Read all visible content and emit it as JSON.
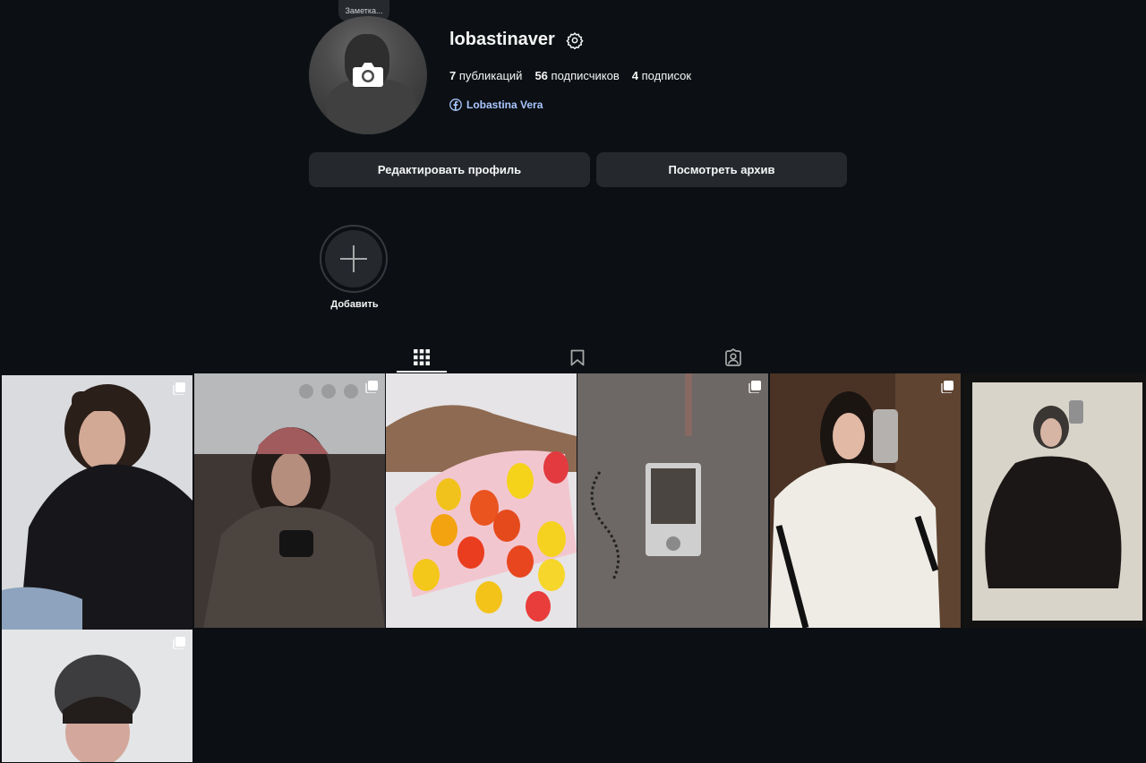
{
  "profile": {
    "note": "Заметка...",
    "username": "lobastinaver",
    "stats": {
      "posts_count": "7",
      "posts_label": "публикаций",
      "followers_count": "56",
      "followers_label": "подписчиков",
      "following_count": "4",
      "following_label": "подписок"
    },
    "facebook_link": "Lobastina Vera"
  },
  "buttons": {
    "edit_profile": "Редактировать профиль",
    "view_archive": "Посмотреть архив"
  },
  "highlights": {
    "add_label": "Добавить"
  },
  "tabs": [
    {
      "name": "posts",
      "icon": "grid-icon",
      "active": true
    },
    {
      "name": "saved",
      "icon": "bookmark-icon",
      "active": false
    },
    {
      "name": "tagged",
      "icon": "tagged-user-icon",
      "active": false
    }
  ],
  "grid": [
    {
      "id": 1,
      "multi": true
    },
    {
      "id": 2,
      "multi": true
    },
    {
      "id": 3,
      "multi": false
    },
    {
      "id": 4,
      "multi": true
    },
    {
      "id": 5,
      "multi": true
    },
    {
      "id": 6,
      "multi": false
    },
    {
      "id": 7,
      "multi": true
    }
  ],
  "colors": {
    "background": "#0c1014",
    "button": "#25292e",
    "link": "#a9c6ff",
    "text": "#f5f5f5"
  }
}
